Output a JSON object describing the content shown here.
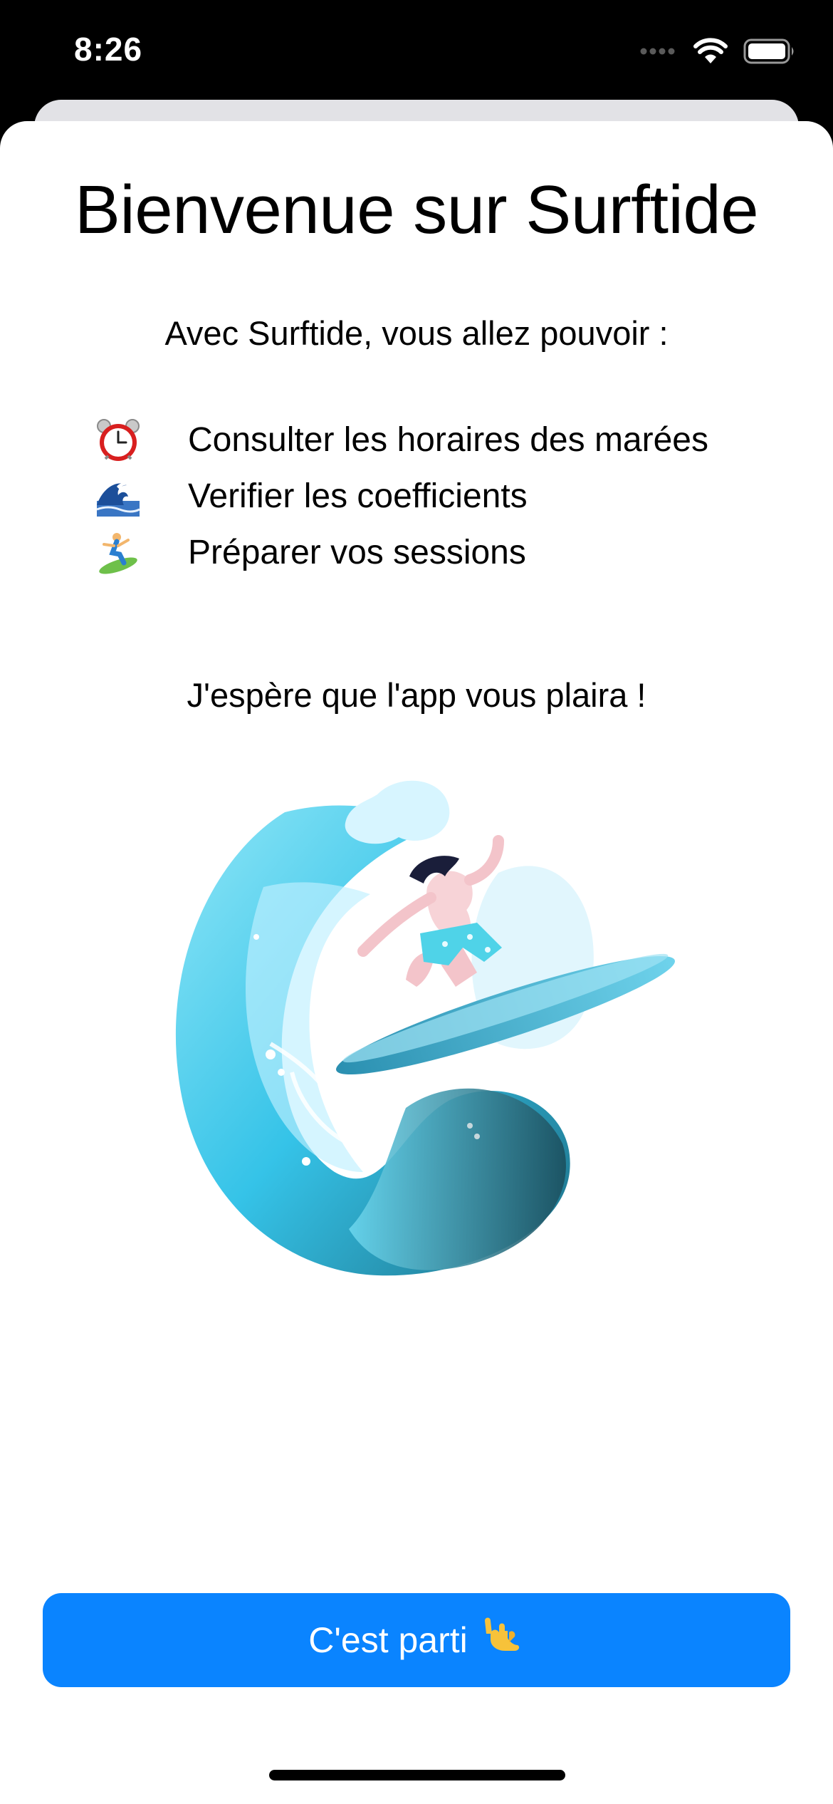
{
  "status_bar": {
    "time": "8:26",
    "icons": [
      "cellular-icon",
      "wifi-icon",
      "battery-icon"
    ]
  },
  "welcome": {
    "title": "Bienvenue sur Surftide",
    "intro": "Avec Surftide, vous allez pouvoir :",
    "features": [
      {
        "icon": "alarm-clock-icon",
        "label": "Consulter les horaires des marées"
      },
      {
        "icon": "wave-icon",
        "label": "Verifier les coefficients"
      },
      {
        "icon": "surfer-icon",
        "label": "Préparer vos sessions"
      }
    ],
    "outro": "J'espère que l'app vous plaira !",
    "illustration": "surfer-on-wave-illustration"
  },
  "cta": {
    "label": "C'est parti",
    "icon": "call-me-hand-icon",
    "color": "#0a84ff"
  }
}
